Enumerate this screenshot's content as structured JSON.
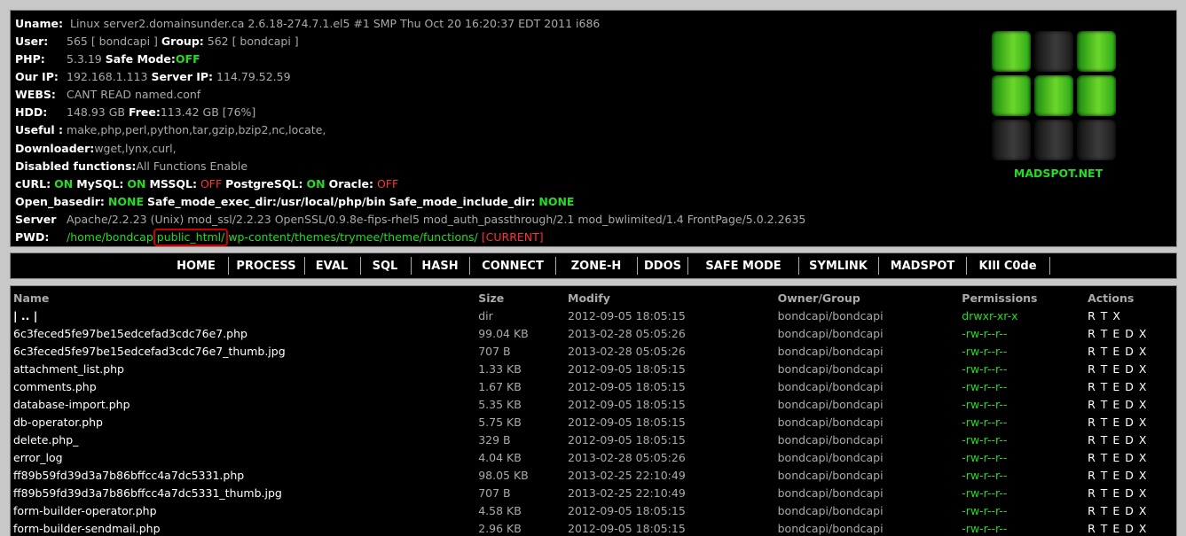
{
  "info": {
    "uname_label": "Uname:",
    "uname_value": "Linux server2.domainsunder.ca 2.6.18-274.7.1.el5 #1 SMP Thu Oct 20 16:20:37 EDT 2011 i686",
    "user_label": "User:",
    "user_value": "565 [ bondcapi ]",
    "group_label": "Group:",
    "group_value": "562 [ bondcapi ]",
    "php_label": "PHP:",
    "php_value": "5.3.19",
    "safe_mode_label": "Safe Mode:",
    "safe_mode_value": "OFF",
    "our_ip_label": "Our IP:",
    "our_ip_value": "192.168.1.113",
    "server_ip_label": "Server IP:",
    "server_ip_value": "114.79.52.59",
    "webs_label": "WEBS:",
    "webs_value": "CANT READ named.conf",
    "hdd_label": "HDD:",
    "hdd_value": "148.93 GB",
    "free_label": "Free:",
    "free_value": "113.42 GB [76%]",
    "useful_label": "Useful :",
    "useful_value": "make,php,perl,python,tar,gzip,bzip2,nc,locate,",
    "downloader_label": "Downloader:",
    "downloader_value": "wget,lynx,curl,",
    "disabled_label": "Disabled functions:",
    "disabled_value": "All Functions Enable",
    "curl_label": "cURL:",
    "curl_value": "ON",
    "mysql_label": "MySQL:",
    "mysql_value": "ON",
    "mssql_label": "MSSQL:",
    "mssql_value": "OFF",
    "pgsql_label": "PostgreSQL:",
    "pgsql_value": "ON",
    "oracle_label": "Oracle:",
    "oracle_value": "OFF",
    "open_basedir_label": "Open_basedir:",
    "open_basedir_value": "NONE",
    "exec_dir_label": "Safe_mode_exec_dir:/usr/local/php/bin",
    "include_dir_label": "Safe_mode_include_dir:",
    "include_dir_value": "NONE",
    "server_label": "Server",
    "server_value": "Apache/2.2.23 (Unix) mod_ssl/2.2.23 OpenSSL/0.9.8e-fips-rhel5 mod_auth_passthrough/2.1 mod_bwlimited/1.4 FrontPage/5.0.2.2635",
    "pwd_label": "PWD:",
    "pwd_part1": "/home/bondcap",
    "pwd_part2": "public_html/",
    "pwd_part3": "wp-content/themes/trymee/theme/functions/",
    "pwd_current": "[CURRENT]"
  },
  "logo_text": "MADSPOT.NET",
  "menu": [
    "HOME",
    "PROCESS",
    "EVAL",
    "SQL",
    "HASH",
    "CONNECT",
    "ZONE-H",
    "DDOS",
    "SAFE MODE",
    "SYMLINK",
    "MADSPOT",
    "KIll C0de"
  ],
  "table": {
    "headers": [
      "Name",
      "Size",
      "Modify",
      "Owner/Group",
      "Permissions",
      "Actions"
    ],
    "rows": [
      [
        "| .. |",
        "dir",
        "2012-09-05 18:05:15",
        "bondcapi/bondcapi",
        "drwxr-xr-x",
        "R T X"
      ],
      [
        "6c3feced5fe97be15edcefad3cdc76e7.php",
        "99.04 KB",
        "2013-02-28 05:05:26",
        "bondcapi/bondcapi",
        "-rw-r--r--",
        "R T E D X"
      ],
      [
        "6c3feced5fe97be15edcefad3cdc76e7_thumb.jpg",
        "707 B",
        "2013-02-28 05:05:26",
        "bondcapi/bondcapi",
        "-rw-r--r--",
        "R T E D X"
      ],
      [
        "attachment_list.php",
        "1.33 KB",
        "2012-09-05 18:05:15",
        "bondcapi/bondcapi",
        "-rw-r--r--",
        "R T E D X"
      ],
      [
        "comments.php",
        "1.67 KB",
        "2012-09-05 18:05:15",
        "bondcapi/bondcapi",
        "-rw-r--r--",
        "R T E D X"
      ],
      [
        "database-import.php",
        "5.35 KB",
        "2012-09-05 18:05:15",
        "bondcapi/bondcapi",
        "-rw-r--r--",
        "R T E D X"
      ],
      [
        "db-operator.php",
        "5.75 KB",
        "2012-09-05 18:05:15",
        "bondcapi/bondcapi",
        "-rw-r--r--",
        "R T E D X"
      ],
      [
        "delete.php_",
        "329 B",
        "2012-09-05 18:05:15",
        "bondcapi/bondcapi",
        "-rw-r--r--",
        "R T E D X"
      ],
      [
        "error_log",
        "4.04 KB",
        "2013-02-28 05:05:26",
        "bondcapi/bondcapi",
        "-rw-r--r--",
        "R T E D X"
      ],
      [
        "ff89b59fd39d3a7b86bffcc4a7dc5331.php",
        "98.05 KB",
        "2013-02-25 22:10:49",
        "bondcapi/bondcapi",
        "-rw-r--r--",
        "R T E D X"
      ],
      [
        "ff89b59fd39d3a7b86bffcc4a7dc5331_thumb.jpg",
        "707 B",
        "2013-02-25 22:10:49",
        "bondcapi/bondcapi",
        "-rw-r--r--",
        "R T E D X"
      ],
      [
        "form-builder-operator.php",
        "4.58 KB",
        "2012-09-05 18:05:15",
        "bondcapi/bondcapi",
        "-rw-r--r--",
        "R T E D X"
      ],
      [
        "form-builder-sendmail.php",
        "2.96 KB",
        "2012-09-05 18:05:15",
        "bondcapi/bondcapi",
        "-rw-r--r--",
        "R T E D X"
      ]
    ]
  },
  "colors": {
    "accent_green": "#22dd22",
    "alert_red": "#ff3333",
    "highlight_border": "#cc0000"
  },
  "logo_cubes": [
    "green",
    "dark",
    "green",
    "green",
    "green",
    "green",
    "dark",
    "dark",
    "dark"
  ]
}
